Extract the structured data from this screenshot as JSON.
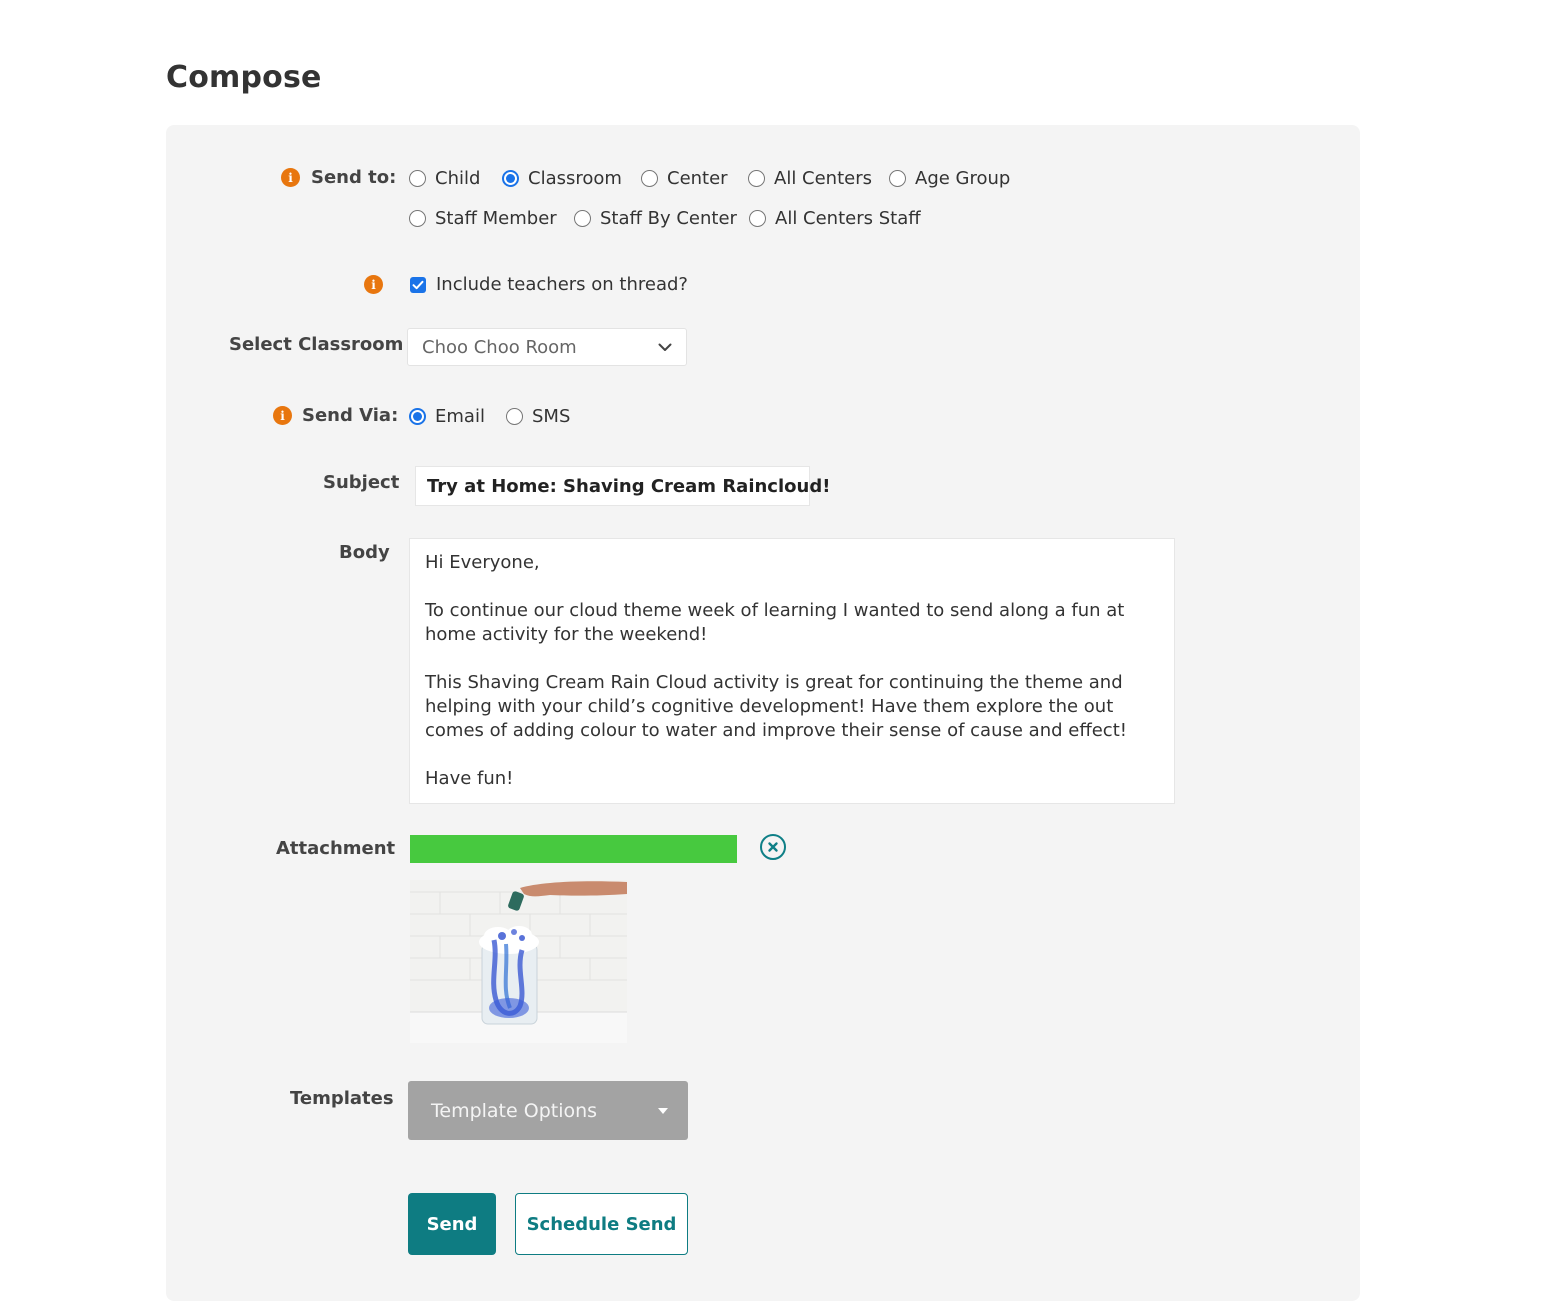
{
  "page": {
    "title": "Compose"
  },
  "send_to": {
    "label": "Send to:",
    "options": [
      {
        "label": "Child",
        "selected": false
      },
      {
        "label": "Classroom",
        "selected": true
      },
      {
        "label": "Center",
        "selected": false
      },
      {
        "label": "All Centers",
        "selected": false
      },
      {
        "label": "Age Group",
        "selected": false
      },
      {
        "label": "Staff Member",
        "selected": false
      },
      {
        "label": "Staff By Center",
        "selected": false
      },
      {
        "label": "All Centers Staff",
        "selected": false
      }
    ]
  },
  "include_teachers": {
    "label": "Include teachers on thread?",
    "checked": true
  },
  "classroom": {
    "label": "Select Classroom",
    "value": "Choo Choo Room"
  },
  "send_via": {
    "label": "Send Via:",
    "options": [
      {
        "label": "Email",
        "selected": true
      },
      {
        "label": "SMS",
        "selected": false
      }
    ]
  },
  "subject": {
    "label": "Subject",
    "value": "Try at Home: Shaving Cream Raincloud!"
  },
  "body": {
    "label": "Body",
    "paragraphs": [
      "Hi Everyone,",
      "To continue our cloud theme week of learning I wanted to send along a fun at home activity for the weekend!",
      "This Shaving Cream Rain Cloud activity is great for continuing the theme and helping with your child’s cognitive development! Have them explore the out comes of adding colour to water and improve their sense of cause and effect!",
      "Have fun!"
    ]
  },
  "attachment": {
    "label": "Attachment",
    "upload_progress": 1.0,
    "thumbnail": "photo-thumbnail"
  },
  "templates": {
    "label": "Templates",
    "button_label": "Template Options"
  },
  "actions": {
    "send_label": "Send",
    "schedule_label": "Schedule Send"
  },
  "colors": {
    "accent": "#0e7c82",
    "info": "#e8760e",
    "progress": "#47c93f",
    "radio_selected": "#1a73e8",
    "panel": "#f4f4f4"
  },
  "icons": {
    "info": "info-icon",
    "remove_attachment": "close-circle-icon",
    "select_chevron": "chevron-down-icon",
    "template_caret": "caret-down-icon"
  }
}
